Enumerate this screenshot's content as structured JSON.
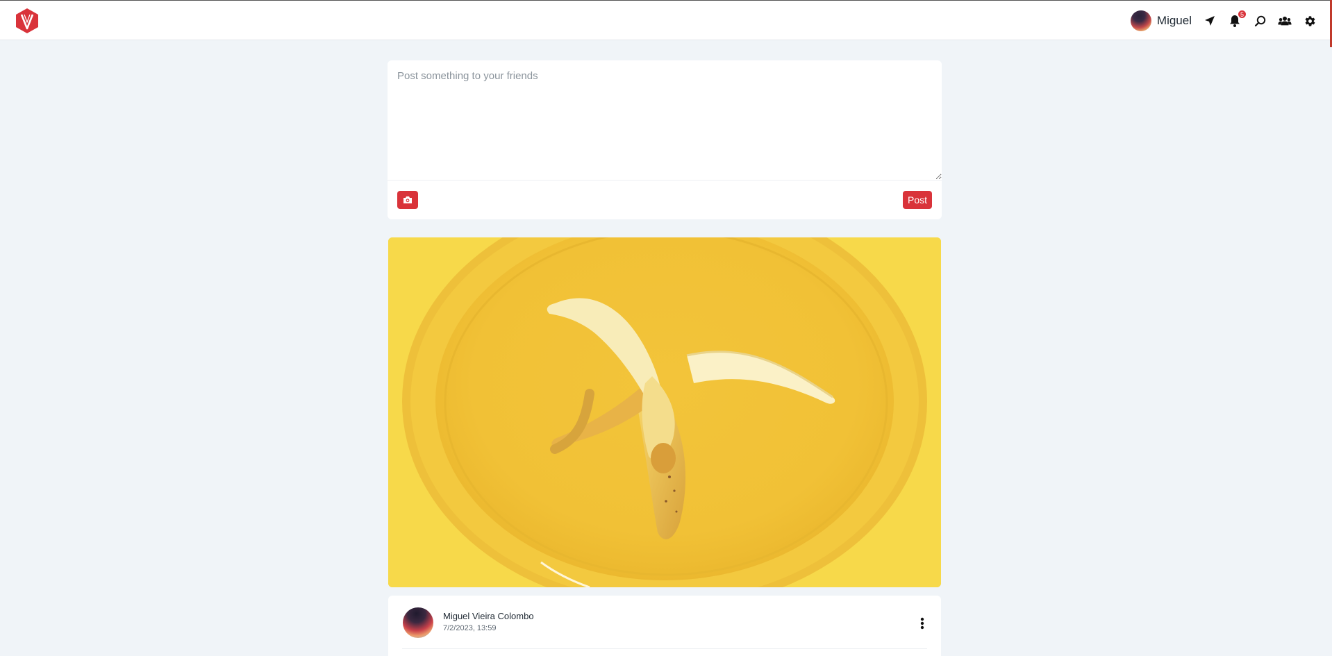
{
  "header": {
    "user_name": "Miguel",
    "notification_count": "5",
    "icons": [
      "logo-icon",
      "send-icon",
      "bell-icon",
      "search-icon",
      "friends-icon",
      "gear-icon"
    ]
  },
  "composer": {
    "placeholder": "Post something to your friends",
    "post_label": "Post",
    "camera_icon": "camera-icon"
  },
  "post": {
    "author": "Miguel Vieira Colombo",
    "timestamp": "7/2/2023, 13:59",
    "image_subject": "peeled banana on yellow plate",
    "menu_icon": "kebab-menu-icon"
  },
  "colors": {
    "accent": "#d9333a",
    "background": "#f0f4f8",
    "card": "#ffffff",
    "image_yellow": "#f6d648"
  }
}
